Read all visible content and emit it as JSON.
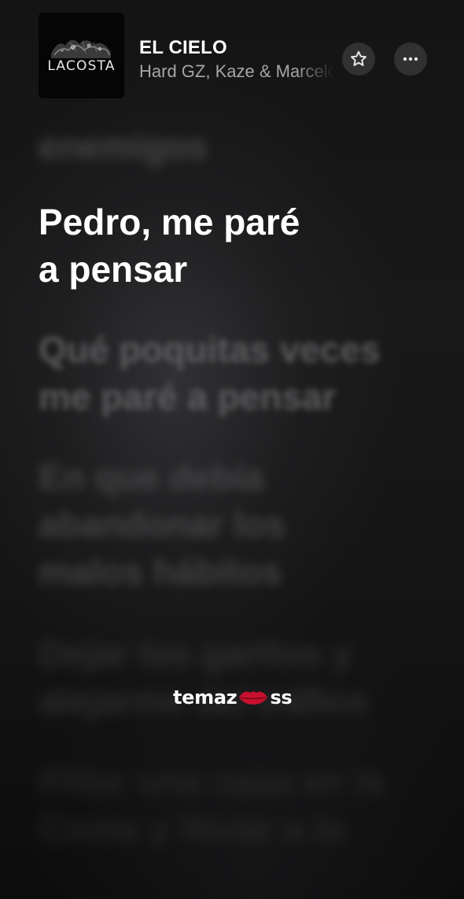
{
  "now_playing": {
    "cover_brand": "LACOSTA",
    "title": "EL CIELO",
    "artists": "Hard GZ, Kaze & Marcelo"
  },
  "actions": {
    "favorite_icon": "star-icon",
    "more_icon": "more-horizontal-icon"
  },
  "lyrics": {
    "previous": "enemigos",
    "current": [
      "Pedro, me paré",
      "a pensar"
    ],
    "upcoming": [
      [
        "Qué poquitas veces",
        "me paré a pensar"
      ],
      [
        "En que debía",
        "abandonar los",
        "malos hábitos"
      ],
      [
        "Dejar los garitos y",
        "alejarme del tráfico"
      ],
      [
        "Pillar una casa en la",
        "Costa y llevar a la"
      ]
    ]
  },
  "watermark": {
    "text_before": "temaz",
    "text_after": "ss",
    "icon": "lips-icon",
    "accent_color": "#c8102e"
  },
  "colors": {
    "background": "#141415",
    "lyric_active": "#ffffff",
    "artist_text": "#a5a5a8"
  }
}
